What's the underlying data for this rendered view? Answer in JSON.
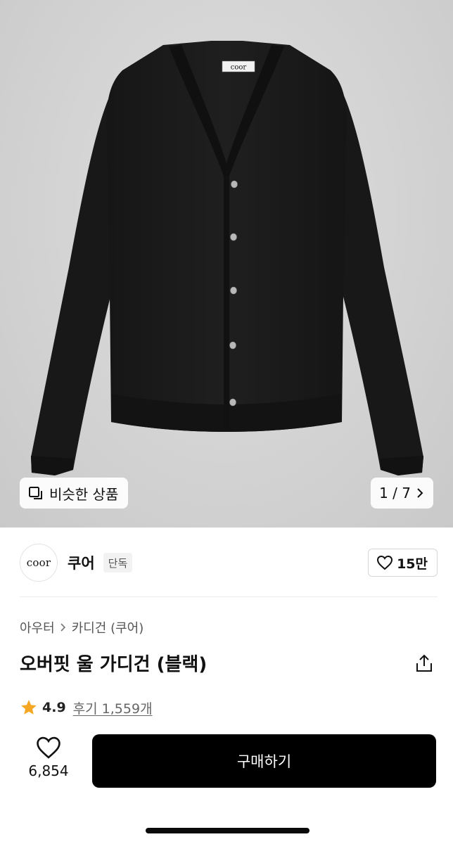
{
  "hero": {
    "image_alt": "black wool cardigan",
    "label_text": "coor",
    "similar_label": "비슷한 상품",
    "pager_text": "1 / 7"
  },
  "brand": {
    "logo_text": "coor",
    "name": "쿠어",
    "badge": "단독",
    "like_count": "15만"
  },
  "breadcrumb": {
    "items": [
      "아우터",
      "카디건 (쿠어)"
    ]
  },
  "product": {
    "title": "오버핏 울 가디건 (블랙)"
  },
  "rating": {
    "score": "4.9",
    "reviews": "후기 1,559개"
  },
  "bottom_bar": {
    "wish_count": "6,854",
    "buy_label": "구매하기"
  },
  "colors": {
    "accent": "#000000",
    "star": "#f5a623",
    "hero_bg": "#d6d6d6"
  }
}
